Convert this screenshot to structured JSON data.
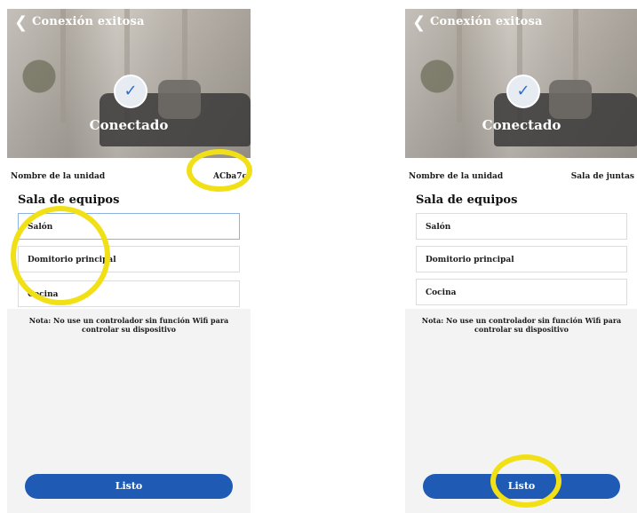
{
  "screens": [
    {
      "header": {
        "title": "Conexión exitosa"
      },
      "hero": {
        "status": "Conectado"
      },
      "unit": {
        "label": "Nombre de la unidad",
        "value": "ACba7c"
      },
      "section": {
        "title": "Sala de equipos"
      },
      "rooms": [
        "Salón",
        "Domitorio principal",
        "Cocina"
      ],
      "note": "Nota: No use un controlador sin función Wifi para controlar su dispositivo",
      "button": {
        "label": "Listo"
      }
    },
    {
      "header": {
        "title": "Conexión exitosa"
      },
      "hero": {
        "status": "Conectado"
      },
      "unit": {
        "label": "Nombre de la unidad",
        "value": "Sala de juntas"
      },
      "section": {
        "title": "Sala de equipos"
      },
      "rooms": [
        "Salón",
        "Domitorio principal",
        "Cocina"
      ],
      "note": "Nota: No use un controlador sin función Wifi para controlar su dispositivo",
      "button": {
        "label": "Listo"
      }
    }
  ],
  "colors": {
    "accent": "#1f5bb5",
    "highlight_circle": "#f2e016",
    "check": "#2b6fd1"
  },
  "icons": {
    "back": "chevron-left-icon",
    "check": "checkmark-icon"
  }
}
